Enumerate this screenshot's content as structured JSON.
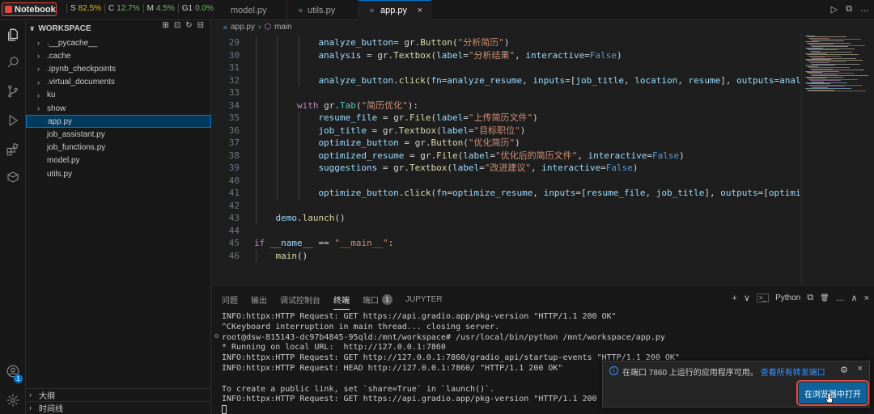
{
  "topbar": {
    "notebook_label": "Notebook",
    "metrics": [
      {
        "key": "S",
        "value": "82.5%",
        "tone": "warn"
      },
      {
        "key": "C",
        "value": "12.7%",
        "tone": "ok"
      },
      {
        "key": "M",
        "value": "4.5%",
        "tone": "ok"
      },
      {
        "key": "G1",
        "value": "0.0%",
        "tone": "ok"
      }
    ],
    "tabs": [
      {
        "label": "model.py"
      },
      {
        "label": "utils.py"
      },
      {
        "label": "app.py",
        "active": true
      }
    ],
    "close_glyph": "×",
    "run_glyph": "▷",
    "split_glyph": "⧉",
    "more_glyph": "…"
  },
  "sidebar": {
    "title": "WORKSPACE",
    "folders": [
      ".__pycache__",
      ".cache",
      ".ipynb_checkpoints",
      ".virtual_documents",
      "ku",
      "show"
    ],
    "files": [
      "app.py",
      "job_assistant.py",
      "job_functions.py",
      "model.py",
      "utils.py"
    ],
    "selected_file": "app.py",
    "outline_label": "大纲",
    "timeline_label": "时间线",
    "account_badge": "1"
  },
  "breadcrumb": {
    "file": "app.py",
    "separator": "›",
    "symbol": "main"
  },
  "editor": {
    "lines": [
      {
        "n": "29",
        "t": [
          [
            "var",
            "analyze_button"
          ],
          [
            "",
            "= gr."
          ],
          [
            "fn",
            "Button"
          ],
          [
            "",
            "("
          ],
          [
            "str",
            "\"分析简历\""
          ],
          [
            "",
            ")"
          ]
        ],
        "indent": 3
      },
      {
        "n": "30",
        "t": [
          [
            "var",
            "analysis"
          ],
          [
            "",
            " = gr."
          ],
          [
            "fn",
            "Textbox"
          ],
          [
            "",
            "("
          ],
          [
            "param",
            "label"
          ],
          [
            "",
            "="
          ],
          [
            "str",
            "\"分析结果\""
          ],
          [
            "",
            ", "
          ],
          [
            "param",
            "interactive"
          ],
          [
            "",
            "="
          ],
          [
            "const",
            "False"
          ],
          [
            "",
            ")"
          ]
        ],
        "indent": 3
      },
      {
        "n": "31",
        "t": [],
        "indent": 3
      },
      {
        "n": "32",
        "t": [
          [
            "var",
            "analyze_button"
          ],
          [
            "",
            "."
          ],
          [
            "fn",
            "click"
          ],
          [
            "",
            "("
          ],
          [
            "param",
            "fn"
          ],
          [
            "",
            "="
          ],
          [
            "var",
            "analyze_resume"
          ],
          [
            "",
            ", "
          ],
          [
            "param",
            "inputs"
          ],
          [
            "",
            "=["
          ],
          [
            "var",
            "job_title"
          ],
          [
            "",
            ", "
          ],
          [
            "var",
            "location"
          ],
          [
            "",
            ", "
          ],
          [
            "var",
            "resume"
          ],
          [
            "",
            "], "
          ],
          [
            "param",
            "outputs"
          ],
          [
            "",
            "="
          ],
          [
            "var",
            "analysis"
          ],
          [
            "",
            ")"
          ]
        ],
        "indent": 3
      },
      {
        "n": "33",
        "t": [],
        "indent": 2
      },
      {
        "n": "34",
        "t": [
          [
            "kw",
            "with"
          ],
          [
            "",
            " gr."
          ],
          [
            "cls",
            "Tab"
          ],
          [
            "",
            "("
          ],
          [
            "str",
            "\"简历优化\""
          ],
          [
            "",
            "):"
          ]
        ],
        "indent": 2
      },
      {
        "n": "35",
        "t": [
          [
            "var",
            "resume_file"
          ],
          [
            "",
            " = gr."
          ],
          [
            "fn",
            "File"
          ],
          [
            "",
            "("
          ],
          [
            "param",
            "label"
          ],
          [
            "",
            "="
          ],
          [
            "str",
            "\"上传简历文件\""
          ],
          [
            "",
            ")"
          ]
        ],
        "indent": 3
      },
      {
        "n": "36",
        "t": [
          [
            "var",
            "job_title"
          ],
          [
            "",
            " = gr."
          ],
          [
            "fn",
            "Textbox"
          ],
          [
            "",
            "("
          ],
          [
            "param",
            "label"
          ],
          [
            "",
            "="
          ],
          [
            "str",
            "\"目标职位\""
          ],
          [
            "",
            ")"
          ]
        ],
        "indent": 3
      },
      {
        "n": "37",
        "t": [
          [
            "var",
            "optimize_button"
          ],
          [
            "",
            " = gr."
          ],
          [
            "fn",
            "Button"
          ],
          [
            "",
            "("
          ],
          [
            "str",
            "\"优化简历\""
          ],
          [
            "",
            ")"
          ]
        ],
        "indent": 3
      },
      {
        "n": "38",
        "t": [
          [
            "var",
            "optimized_resume"
          ],
          [
            "",
            " = gr."
          ],
          [
            "fn",
            "File"
          ],
          [
            "",
            "("
          ],
          [
            "param",
            "label"
          ],
          [
            "",
            "="
          ],
          [
            "str",
            "\"优化后的简历文件\""
          ],
          [
            "",
            ", "
          ],
          [
            "param",
            "interactive"
          ],
          [
            "",
            "="
          ],
          [
            "const",
            "False"
          ],
          [
            "",
            ")"
          ]
        ],
        "indent": 3
      },
      {
        "n": "39",
        "t": [
          [
            "var",
            "suggestions"
          ],
          [
            "",
            " = gr."
          ],
          [
            "fn",
            "Textbox"
          ],
          [
            "",
            "("
          ],
          [
            "param",
            "label"
          ],
          [
            "",
            "="
          ],
          [
            "str",
            "\"改进建议\""
          ],
          [
            "",
            ", "
          ],
          [
            "param",
            "interactive"
          ],
          [
            "",
            "="
          ],
          [
            "const",
            "False"
          ],
          [
            "",
            ")"
          ]
        ],
        "indent": 3
      },
      {
        "n": "40",
        "t": [],
        "indent": 3
      },
      {
        "n": "41",
        "t": [
          [
            "var",
            "optimize_button"
          ],
          [
            "",
            "."
          ],
          [
            "fn",
            "click"
          ],
          [
            "",
            "("
          ],
          [
            "param",
            "fn"
          ],
          [
            "",
            "="
          ],
          [
            "var",
            "optimize_resume"
          ],
          [
            "",
            ", "
          ],
          [
            "param",
            "inputs"
          ],
          [
            "",
            "=["
          ],
          [
            "var",
            "resume_file"
          ],
          [
            "",
            ", "
          ],
          [
            "var",
            "job_title"
          ],
          [
            "",
            "], "
          ],
          [
            "param",
            "outputs"
          ],
          [
            "",
            "=["
          ],
          [
            "var",
            "optimized_re"
          ]
        ],
        "indent": 3
      },
      {
        "n": "42",
        "t": [],
        "indent": 1
      },
      {
        "n": "43",
        "t": [
          [
            "var",
            "demo"
          ],
          [
            "",
            "."
          ],
          [
            "fn",
            "launch"
          ],
          [
            "",
            "()"
          ]
        ],
        "indent": 1
      },
      {
        "n": "44",
        "t": [],
        "indent": 0
      },
      {
        "n": "45",
        "t": [
          [
            "kw",
            "if"
          ],
          [
            "",
            " "
          ],
          [
            "var",
            "__name__"
          ],
          [
            "",
            " == "
          ],
          [
            "str",
            "\"__main__\""
          ],
          [
            "",
            ":"
          ]
        ],
        "indent": 0
      },
      {
        "n": "46",
        "t": [
          [
            "fn",
            "main"
          ],
          [
            "",
            "()"
          ]
        ],
        "indent": 1
      }
    ]
  },
  "panel": {
    "tabs": [
      {
        "label": "问题"
      },
      {
        "label": "输出"
      },
      {
        "label": "调试控制台"
      },
      {
        "label": "终端",
        "active": true
      },
      {
        "label": "端口",
        "badge": "1"
      },
      {
        "label": "JUPYTER"
      }
    ],
    "actions": {
      "add": "+",
      "dropdown": "∨",
      "shell": "Python",
      "split": "⧉",
      "trash": "🗑",
      "more": "…",
      "maximize": "∧",
      "close": "×"
    },
    "terminal_lines": [
      "INFO:httpx:HTTP Request: GET https://api.gradio.app/pkg-version \"HTTP/1.1 200 OK\"",
      "^CKeyboard interruption in main thread... closing server.",
      "root@dsw-815143-dc97b4845-95qld:/mnt/workspace# /usr/local/bin/python /mnt/workspace/app.py",
      "* Running on local URL:  http://127.0.0.1:7860",
      "INFO:httpx:HTTP Request: GET http://127.0.0.1:7860/gradio_api/startup-events \"HTTP/1.1 200 OK\"",
      "INFO:httpx:HTTP Request: HEAD http://127.0.0.1:7860/ \"HTTP/1.1 200 OK\"",
      "",
      "To create a public link, set `share=True` in `launch()`.",
      "INFO:httpx:HTTP Request: GET https://api.gradio.app/pkg-version \"HTTP/1.1 200 OK\""
    ]
  },
  "notification": {
    "message": "在端口 7860 上运行的应用程序可用。",
    "link": "查看所有转发端口",
    "button": "在浏览器中打开",
    "info_glyph": "i",
    "gear_glyph": "⚙",
    "close_glyph": "×"
  },
  "colors": {
    "accent": "#0078d4",
    "highlight_red": "#e2483d",
    "button_blue": "#0e639c"
  }
}
